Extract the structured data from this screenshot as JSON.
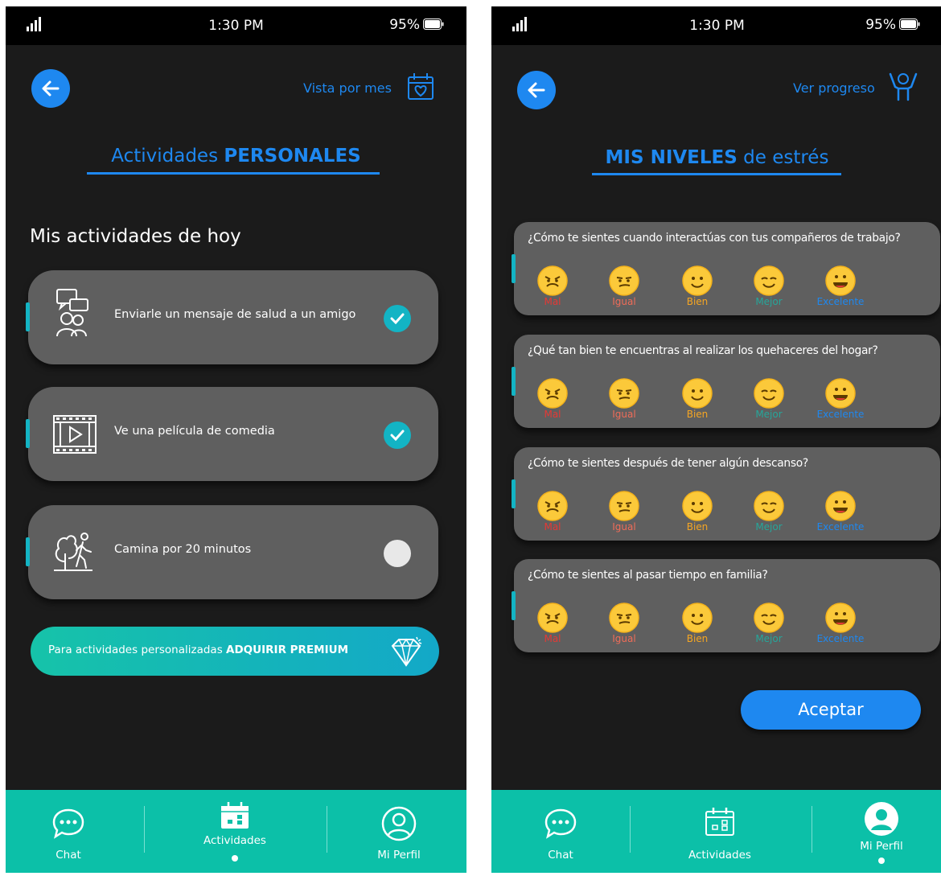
{
  "status": {
    "time": "1:30 PM",
    "battery": "95%"
  },
  "left": {
    "toplink": "Vista por mes",
    "title_regular": "Actividades ",
    "title_bold": "PERSONALES",
    "section_title": "Mis actividades de hoy",
    "activities": [
      {
        "label": "Enviarle un mensaje de salud a un amigo",
        "icon": "chat-friends-icon",
        "done": true
      },
      {
        "label": "Ve una película de comedia",
        "icon": "film-icon",
        "done": true
      },
      {
        "label": "Camina por 20 minutos",
        "icon": "walk-tree-icon",
        "done": false
      }
    ],
    "premium_text": "Para actividades personalizadas ",
    "premium_bold": "ADQUIRIR PREMIUM",
    "nav": {
      "chat": "Chat",
      "activities": "Actividades",
      "profile": "Mi Perfil",
      "active": "activities"
    }
  },
  "right": {
    "toplink": "Ver progreso",
    "title_bold": "MIS NIVELES",
    "title_regular": " de estrés",
    "questions": [
      "¿Cómo te sientes cuando interactúas con tus compañeros de trabajo?",
      "¿Qué tan bien te encuentras al realizar los quehaceres del hogar?",
      "¿Cómo te sientes después de tener algún descanso?",
      "¿Cómo te sientes al pasar  tiempo en familia?"
    ],
    "ratings": [
      "Mal",
      "Igual",
      "Bien",
      "Mejor",
      "Excelente"
    ],
    "accept_label": "Aceptar",
    "nav": {
      "chat": "Chat",
      "activities": "Actividades",
      "profile": "Mi Perfil",
      "active": "profile"
    }
  },
  "colors": {
    "accent_blue": "#1e88f0",
    "teal": "#13b4c4",
    "nav_bg": "#0cc0a8",
    "rating_mal": "#e53935",
    "rating_igual": "#ef6c58",
    "rating_bien": "#f5a623",
    "rating_mejor": "#26a69a",
    "rating_excelente": "#1e88f0"
  }
}
